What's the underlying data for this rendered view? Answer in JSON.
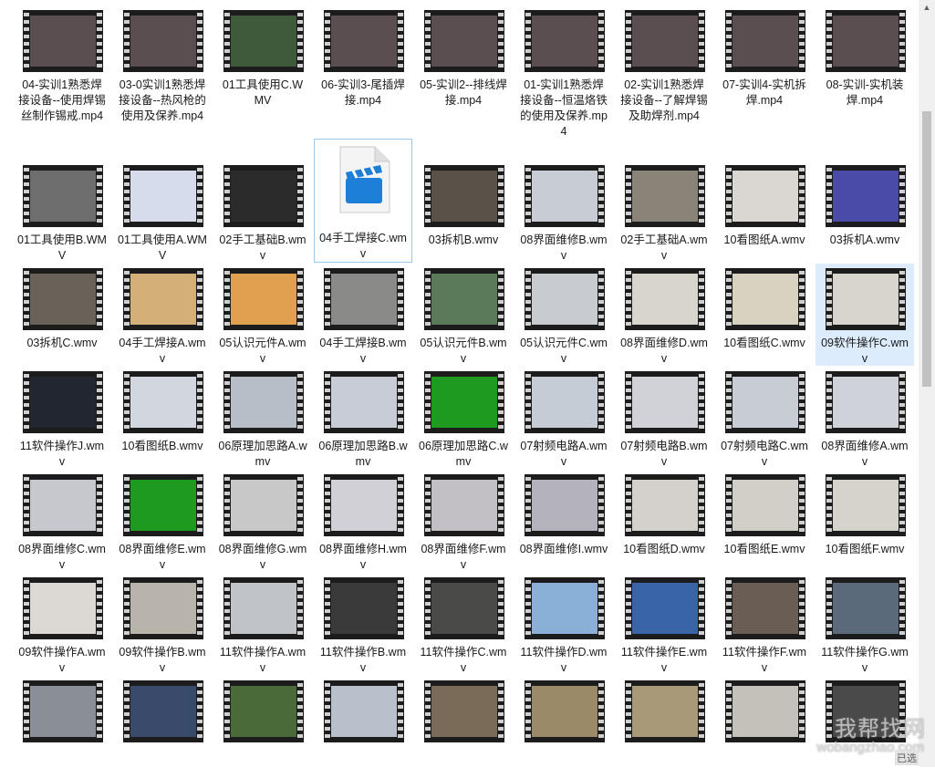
{
  "window": {
    "title": ""
  },
  "files": [
    {
      "label": "04-实训1熟悉焊接设备--使用焊锡丝制作锡戒.mp4",
      "thumb": "#5a4e50"
    },
    {
      "label": "03-0实训1熟悉焊接设备--热风枪的使用及保养.mp4",
      "thumb": "#5a4e50"
    },
    {
      "label": "01工具使用C.WMV",
      "thumb": "#3e5a3a"
    },
    {
      "label": "06-实训3-尾插焊接.mp4",
      "thumb": "#5a4e50"
    },
    {
      "label": "05-实训2--排线焊接.mp4",
      "thumb": "#5a4e50"
    },
    {
      "label": "01-实训1熟悉焊接设备--恒温烙铁的使用及保养.mp4",
      "thumb": "#5a4e50"
    },
    {
      "label": "02-实训1熟悉焊接设备--了解焊锡及助焊剂.mp4",
      "thumb": "#5a4e50"
    },
    {
      "label": "07-实训4-实机拆焊.mp4",
      "thumb": "#5a4e50"
    },
    {
      "label": "08-实训-实机装焊.mp4",
      "thumb": "#5a4e50"
    },
    {
      "label": "01工具使用B.WMV",
      "thumb": "#6e6e6e"
    },
    {
      "label": "01工具使用A.WMV",
      "thumb": "#d6dceb"
    },
    {
      "label": "02手工基础B.wmv",
      "thumb": "#2b2b2b"
    },
    {
      "label": "04手工焊接C.wmv",
      "thumb": "",
      "icon": true
    },
    {
      "label": "03拆机B.wmv",
      "thumb": "#5a5248"
    },
    {
      "label": "08界面维修B.wmv",
      "thumb": "#c8ccd4"
    },
    {
      "label": "02手工基础A.wmv",
      "thumb": "#8a8478"
    },
    {
      "label": "10看图纸A.wmv",
      "thumb": "#dad6d2"
    },
    {
      "label": "03拆机A.wmv",
      "thumb": "#4a4aa8"
    },
    {
      "label": "03拆机C.wmv",
      "thumb": "#6a6258"
    },
    {
      "label": "04手工焊接A.wmv",
      "thumb": "#d4b078"
    },
    {
      "label": "05认识元件A.wmv",
      "thumb": "#e0a050"
    },
    {
      "label": "04手工焊接B.wmv",
      "thumb": "#8a8a88"
    },
    {
      "label": "05认识元件B.wmv",
      "thumb": "#5a7a5a"
    },
    {
      "label": "05认识元件C.wmv",
      "thumb": "#c8ccd0"
    },
    {
      "label": "08界面维修D.wmv",
      "thumb": "#d8d4ce"
    },
    {
      "label": "10看图纸C.wmv",
      "thumb": "#d8d2c0"
    },
    {
      "label": "09软件操作C.wmv",
      "thumb": "#d8d4ce",
      "selected": true
    },
    {
      "label": "11软件操作J.wmv",
      "thumb": "#222630"
    },
    {
      "label": "10看图纸B.wmv",
      "thumb": "#d2d6de"
    },
    {
      "label": "06原理加思路A.wmv",
      "thumb": "#b8bec8"
    },
    {
      "label": "06原理加思路B.wmv",
      "thumb": "#c8ccd6"
    },
    {
      "label": "06原理加思路C.wmv",
      "thumb": "#1e9a1e"
    },
    {
      "label": "07射频电路A.wmv",
      "thumb": "#c6ccd6"
    },
    {
      "label": "07射频电路B.wmv",
      "thumb": "#d0d2d8"
    },
    {
      "label": "07射频电路C.wmv",
      "thumb": "#c8ccd4"
    },
    {
      "label": "08界面维修A.wmv",
      "thumb": "#d0d2da"
    },
    {
      "label": "08界面维修C.wmv",
      "thumb": "#c6c8ce"
    },
    {
      "label": "08界面维修E.wmv",
      "thumb": "#1e9a1e"
    },
    {
      "label": "08界面维修G.wmv",
      "thumb": "#c8c8c8"
    },
    {
      "label": "08界面维修H.wmv",
      "thumb": "#d0d0d6"
    },
    {
      "label": "08界面维修F.wmv",
      "thumb": "#c2c0c4"
    },
    {
      "label": "08界面维修I.wmv",
      "thumb": "#b4b2bc"
    },
    {
      "label": "10看图纸D.wmv",
      "thumb": "#d4d0cc"
    },
    {
      "label": "10看图纸E.wmv",
      "thumb": "#d2cec8"
    },
    {
      "label": "10看图纸F.wmv",
      "thumb": "#d6d2cc"
    },
    {
      "label": "09软件操作A.wmv",
      "thumb": "#dcd8d4"
    },
    {
      "label": "09软件操作B.wmv",
      "thumb": "#b8b4ac"
    },
    {
      "label": "11软件操作A.wmv",
      "thumb": "#c0c4c8"
    },
    {
      "label": "11软件操作B.wmv",
      "thumb": "#3a3a3a"
    },
    {
      "label": "11软件操作C.wmv",
      "thumb": "#4a4a48"
    },
    {
      "label": "11软件操作D.wmv",
      "thumb": "#8ab0d8"
    },
    {
      "label": "11软件操作E.wmv",
      "thumb": "#3a64a8"
    },
    {
      "label": "11软件操作F.wmv",
      "thumb": "#6a5e54"
    },
    {
      "label": "11软件操作G.wmv",
      "thumb": "#5a6a7a"
    },
    {
      "label": "",
      "thumb": "#8a8e96"
    },
    {
      "label": "",
      "thumb": "#3a4a6a"
    },
    {
      "label": "",
      "thumb": "#4a6a3a"
    },
    {
      "label": "",
      "thumb": "#b8c0cc"
    },
    {
      "label": "",
      "thumb": "#7a6a58"
    },
    {
      "label": "",
      "thumb": "#9a8a68"
    },
    {
      "label": "",
      "thumb": "#a89a78"
    },
    {
      "label": "",
      "thumb": "#c4c0ba"
    },
    {
      "label": "",
      "thumb": "#4a4a4a"
    }
  ],
  "watermark": {
    "text": "我帮找网",
    "url": "wobangzhao.com",
    "sub": "已选"
  }
}
